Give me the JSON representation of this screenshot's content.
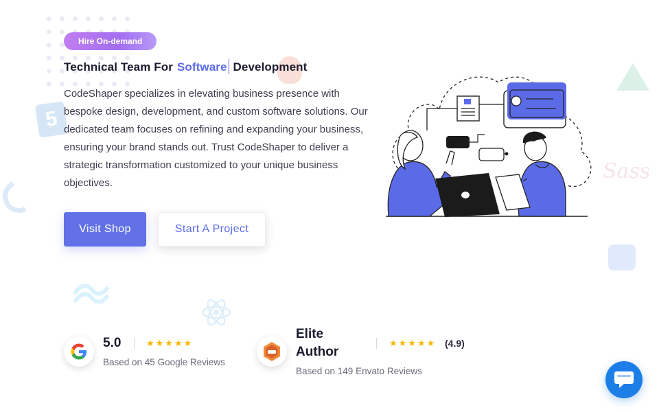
{
  "hero": {
    "badge": "Hire On-demand",
    "headline_pre": "Technical Team For",
    "headline_accent": "Software",
    "headline_post": "Development",
    "description": "CodeShaper specializes in elevating business presence with bespoke design, development, and custom software solutions. Our dedicated team focuses on refining and expanding your business, ensuring your brand stands out. Trust CodeShaper to deliver a strategic transformation customized to your unique business objectives.",
    "primary_button": "Visit Shop",
    "secondary_button": "Start A Project"
  },
  "ratings": {
    "google": {
      "score": "5.0",
      "stars": "★★★★★",
      "sub": "Based on 45 Google Reviews"
    },
    "envato": {
      "title_line1": "Elite",
      "title_line2": "Author",
      "stars": "★★★★★",
      "score": "(4.9)",
      "sub": "Based on 149 Envato Reviews"
    }
  },
  "icons": {
    "google": "google-logo-icon",
    "envato": "envato-elite-badge-icon",
    "chat": "chat-bubble-icon"
  },
  "colors": {
    "accent": "#5b6be8",
    "primary_button": "#6272e6",
    "star": "#f6b700",
    "chat": "#1d7ee8"
  }
}
